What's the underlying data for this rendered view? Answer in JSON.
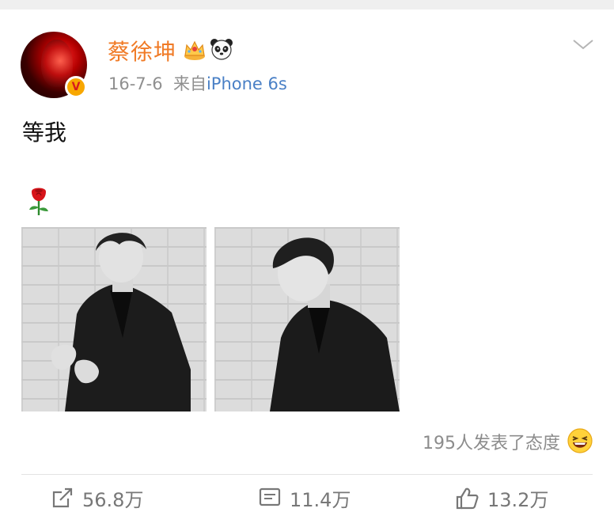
{
  "post": {
    "author": {
      "name": "蔡徐坤",
      "verified_badge": "V",
      "badges": [
        "crown-icon",
        "panda-icon"
      ]
    },
    "date": "16-7-6",
    "source_prefix": "来自",
    "source_device": "iPhone 6s",
    "text": "等我",
    "emoji": "rose-icon",
    "photos": [
      "photo-1",
      "photo-2"
    ],
    "reactions_text": "195人发表了态度",
    "reaction_icon": "laughing-face-icon"
  },
  "actions": {
    "repost": "56.8万",
    "comment": "11.4万",
    "like": "13.2万"
  },
  "colors": {
    "username": "#f07a25",
    "device_link": "#4a80c6",
    "meta": "#8f8f8f",
    "verified": "#f8a700"
  }
}
